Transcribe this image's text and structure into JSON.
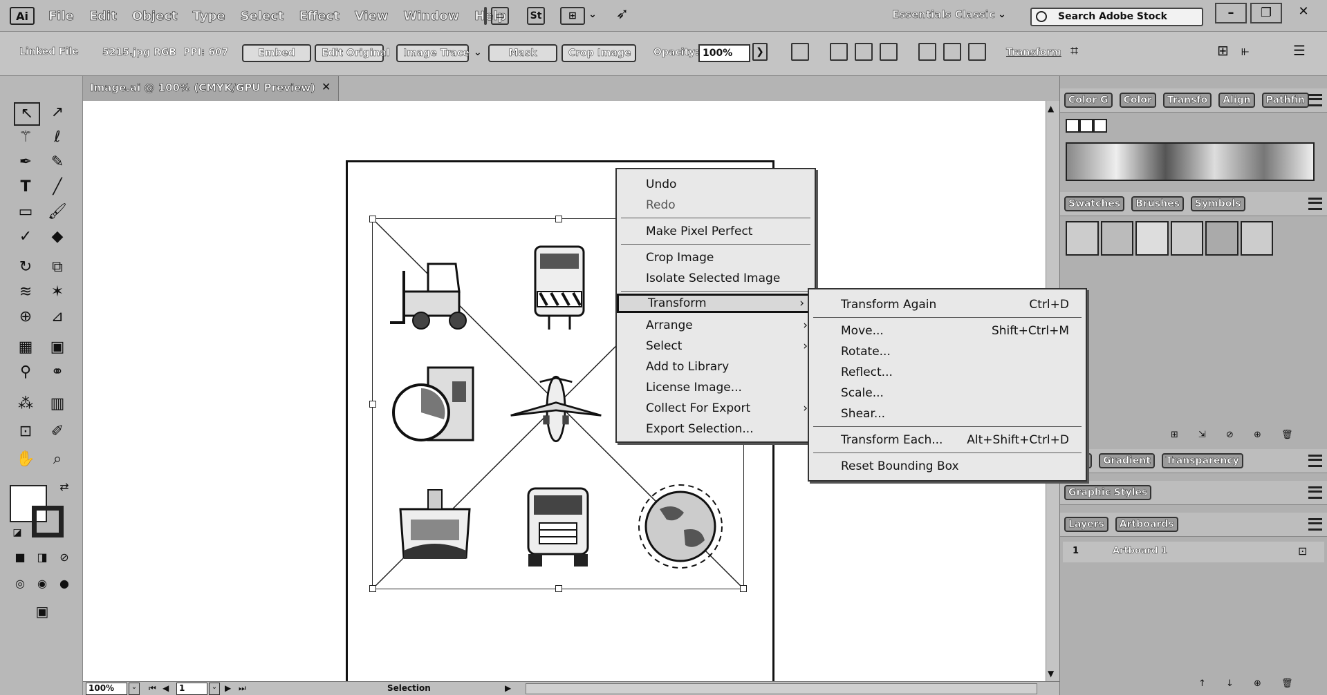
{
  "app": {
    "logo": "Ai",
    "menus": [
      "File",
      "Edit",
      "Object",
      "Type",
      "Select",
      "Effect",
      "View",
      "Window",
      "Help"
    ],
    "bridge_label": "St",
    "workspace": "Essentials Classic",
    "search_placeholder": "Search Adobe Stock",
    "window_controls": [
      "–",
      "❐",
      "✕"
    ]
  },
  "control_bar": {
    "linked_file": "Linked File",
    "file_name": "5215.jpg",
    "color_mode": "RGB",
    "ppi": "PPI: 607",
    "embed": "Embed",
    "edit_original": "Edit Original",
    "image_trace": "Image Trace",
    "mask": "Mask",
    "crop_image": "Crop Image",
    "opacity_label": "Opacity:",
    "opacity_value": "100%",
    "transform": "Transform"
  },
  "document": {
    "tab_title": "Image.ai @ 100% (CMYK/GPU Preview)",
    "close": "✕"
  },
  "status_bar": {
    "zoom": "100%",
    "artboard_number": "1",
    "tool_name": "Selection"
  },
  "context_menu": {
    "items": [
      {
        "label": "Undo",
        "disabled": false
      },
      {
        "label": "Redo",
        "disabled": true
      },
      {
        "label": "Make Pixel Perfect",
        "disabled": false
      },
      {
        "label": "Crop Image",
        "disabled": false
      },
      {
        "label": "Isolate Selected Image",
        "disabled": false
      },
      {
        "label": "Transform",
        "disabled": false,
        "submenu": true,
        "highlighted": true
      },
      {
        "label": "Arrange",
        "disabled": false,
        "submenu": true
      },
      {
        "label": "Select",
        "disabled": false,
        "submenu": true
      },
      {
        "label": "Add to Library",
        "disabled": false
      },
      {
        "label": "License Image...",
        "disabled": false
      },
      {
        "label": "Collect For Export",
        "disabled": false,
        "submenu": true
      },
      {
        "label": "Export Selection...",
        "disabled": false
      }
    ]
  },
  "transform_submenu": {
    "items": [
      {
        "label": "Transform Again",
        "shortcut": "Ctrl+D"
      },
      {
        "label": "Move...",
        "shortcut": "Shift+Ctrl+M"
      },
      {
        "label": "Rotate...",
        "shortcut": ""
      },
      {
        "label": "Reflect...",
        "shortcut": ""
      },
      {
        "label": "Scale...",
        "shortcut": ""
      },
      {
        "label": "Shear...",
        "shortcut": ""
      },
      {
        "label": "Transform Each...",
        "shortcut": "Alt+Shift+Ctrl+D"
      },
      {
        "label": "Reset Bounding Box",
        "shortcut": ""
      }
    ]
  },
  "panels": {
    "color_tabs": [
      "Color G",
      "Color",
      "Transfo",
      "Align",
      "Pathfin"
    ],
    "swatch_tabs": [
      "Swatches",
      "Brushes",
      "Symbols"
    ],
    "stroke_tabs": [
      "oke",
      "Gradient",
      "Transparency"
    ],
    "graphic_styles": "Graphic Styles",
    "layer_tabs": [
      "Layers",
      "Artboards"
    ],
    "artboard_row": {
      "number": "1",
      "name": "Artboard 1"
    }
  }
}
